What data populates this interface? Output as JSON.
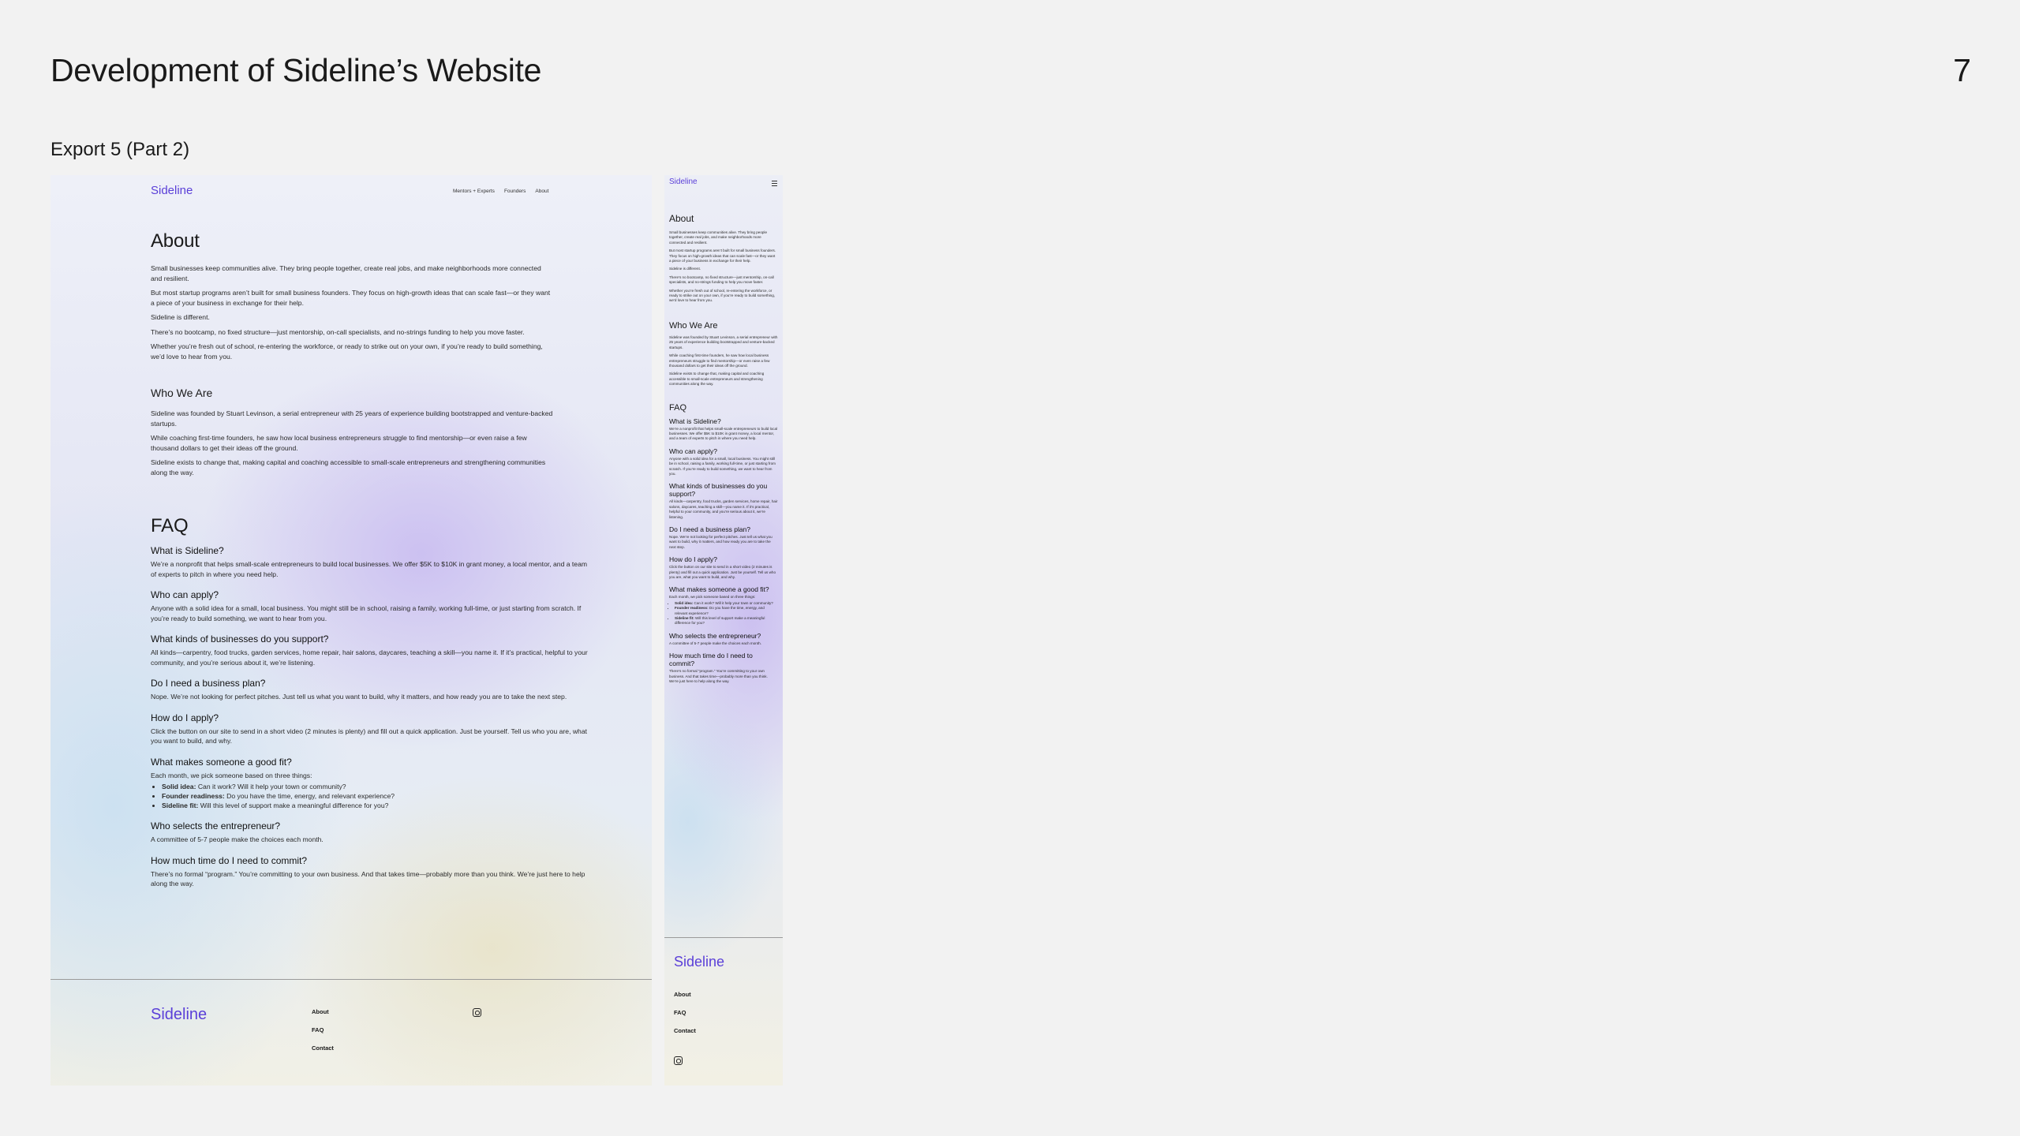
{
  "slide": {
    "title": "Development of Sideline’s Website",
    "number": "7",
    "subtitle": "Export 5 (Part 2)"
  },
  "brand": "Sideline",
  "nav": [
    "Mentors + Experts",
    "Founders",
    "About"
  ],
  "about": {
    "heading": "About",
    "paragraphs": [
      "Small businesses keep communities alive. They bring people together, create real jobs, and make neighborhoods more connected and resilient.",
      "But most startup programs aren’t built for small business founders. They focus on high-growth ideas that can scale fast—or they want a piece of your business in exchange for their help.",
      "Sideline is different.",
      "There’s no bootcamp, no fixed structure—just mentorship, on-call specialists, and no-strings funding to help you move faster.",
      "Whether you’re fresh out of school, re-entering the workforce, or ready to strike out on your own, if you’re ready to build something, we’d love to hear from you."
    ]
  },
  "who": {
    "heading": "Who We Are",
    "paragraphs": [
      "Sideline was founded by Stuart Levinson, a serial entrepreneur with 25 years of experience building bootstrapped and venture-backed startups.",
      "While coaching first-time founders, he saw how local business entrepreneurs struggle to find mentorship—or even raise a few thousand dollars to get their ideas off the ground.",
      "Sideline exists to change that, making capital and coaching accessible to small-scale entrepreneurs and strengthening communities along the way."
    ]
  },
  "faq": {
    "heading": "FAQ",
    "items": [
      {
        "q": "What is Sideline?",
        "a": "We’re a nonprofit that helps small-scale entrepreneurs to build local businesses. We offer $5K to $10K in grant money, a local mentor, and a team of experts to pitch in where you need help."
      },
      {
        "q": "Who can apply?",
        "a": "Anyone with a solid idea for a small, local business. You might still be in school, raising a family, working full-time, or just starting from scratch. If you’re ready to build something, we want to hear from you."
      },
      {
        "q": "What kinds of businesses do you support?",
        "a": "All kinds—carpentry, food trucks, garden services, home repair, hair salons, daycares, teaching a skill—you name it. If it’s practical, helpful to your community, and you’re serious about it, we’re listening."
      },
      {
        "q": "Do I need a business plan?",
        "a": "Nope. We’re not looking for perfect pitches. Just tell us what you want to build, why it matters, and how ready you are to take the next step."
      },
      {
        "q": "How do I apply?",
        "a": "Click the button on our site to send in a short video (2 minutes is plenty) and fill out a quick application. Just be yourself. Tell us who you are, what you want to build, and why."
      },
      {
        "q": "What makes someone a good fit?",
        "a": "Each month, we pick someone based on three things:"
      },
      {
        "q": "Who selects the entrepreneur?",
        "a": "A committee of 5-7 people make the choices each month."
      },
      {
        "q": "How much time do I need to commit?",
        "a": "There’s no formal “program.” You’re committing to your own business. And that takes time—probably more than you think. We’re just here to help along the way."
      }
    ],
    "fit_list": [
      {
        "label": "Solid idea:",
        "text": " Can it work? Will it help your town or community?"
      },
      {
        "label": "Founder readiness:",
        "text": " Do you have the time, energy, and relevant experience?"
      },
      {
        "label": "Sideline fit:",
        "text": " Will this level of support make a meaningful difference for you?"
      }
    ]
  },
  "footer": {
    "links": [
      "About",
      "FAQ",
      "Contact"
    ],
    "social_icon": "instagram-icon"
  },
  "colors": {
    "brand": "#5a3fd8",
    "background": "#f2f2f2"
  }
}
